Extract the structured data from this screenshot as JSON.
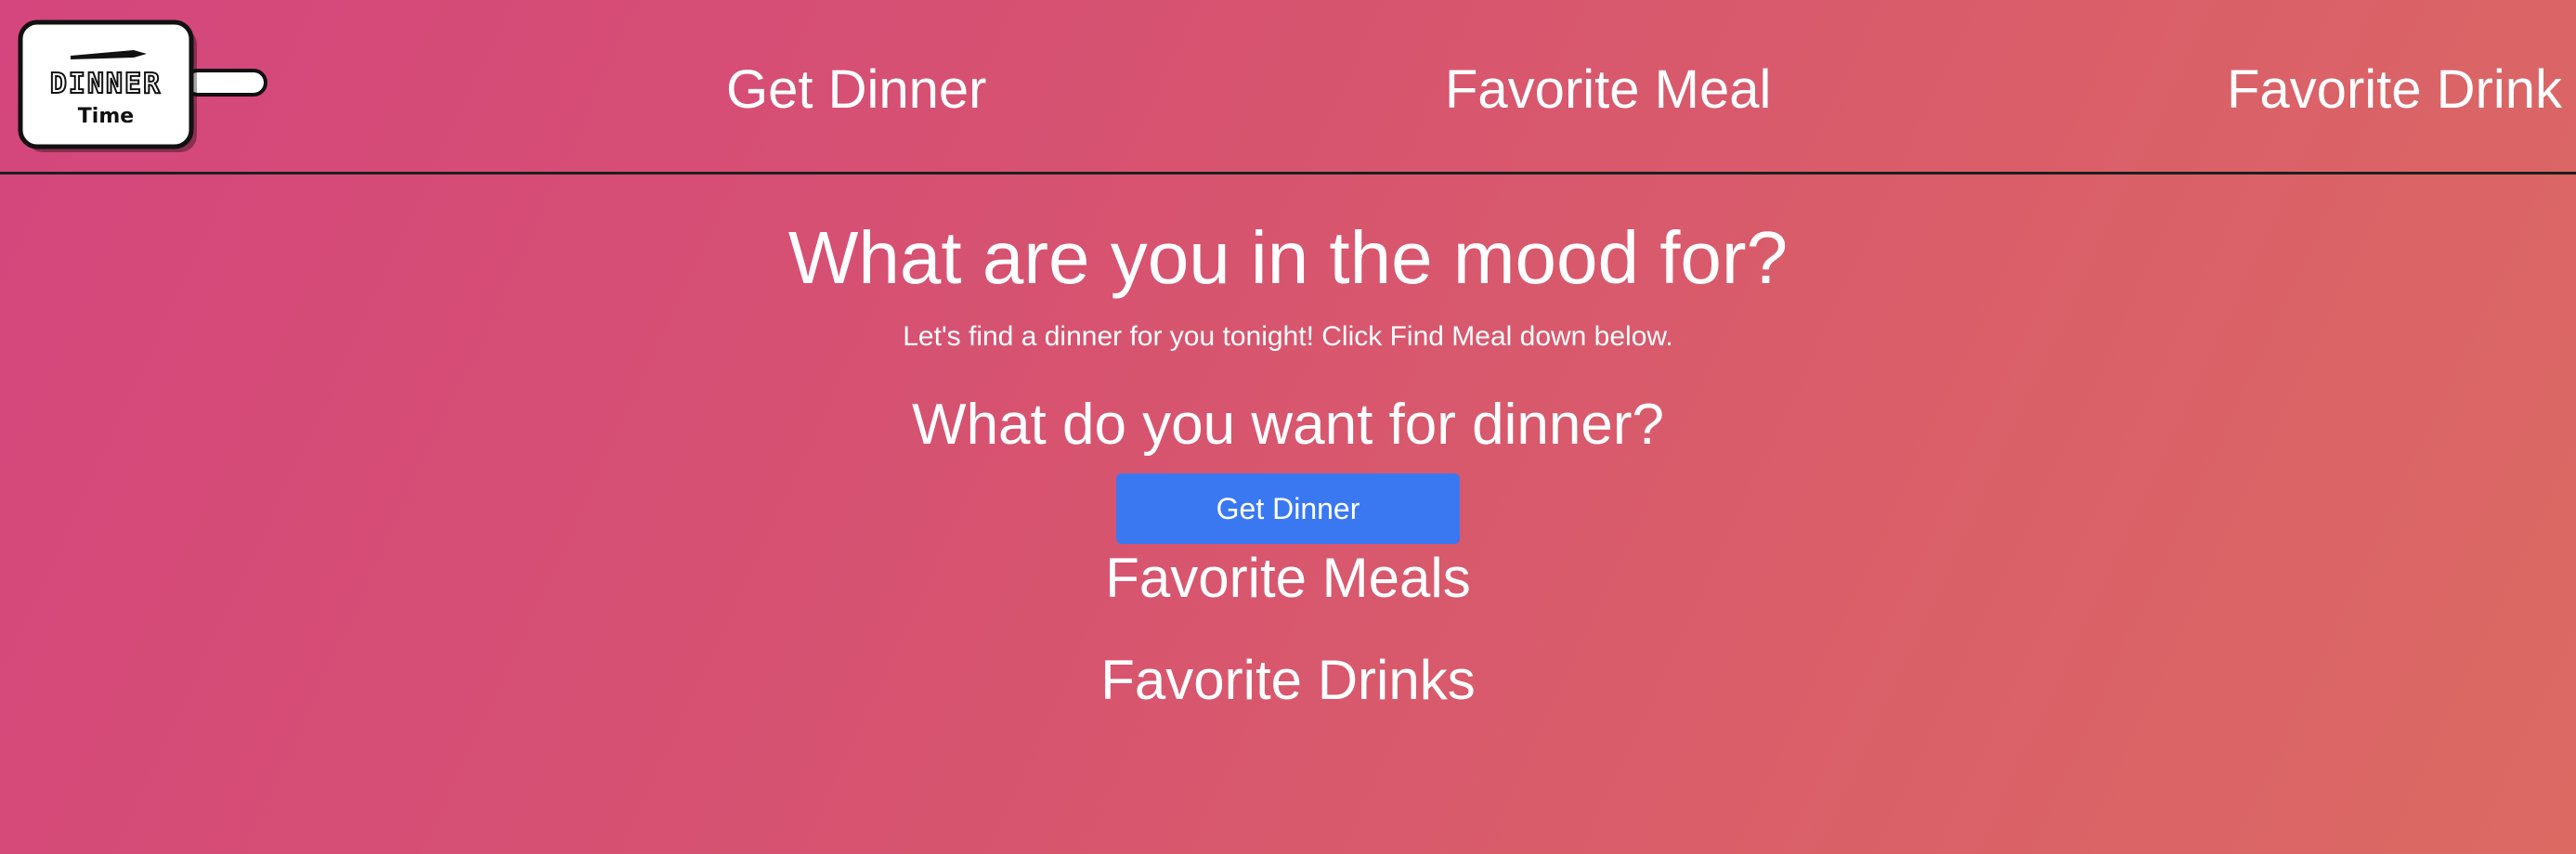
{
  "logo": {
    "line1": "DINNER",
    "line2": "Time",
    "icon": "dinner-plate-pan-icon"
  },
  "nav": {
    "items": [
      {
        "label": "Get Dinner"
      },
      {
        "label": "Favorite Meal"
      },
      {
        "label": "Favorite Drink"
      }
    ]
  },
  "main": {
    "headline": "What are you in the mood for?",
    "subtitle": "Let's find a dinner for you tonight! Click Find Meal down below.",
    "question": "What do you want for dinner?",
    "get_dinner_button": "Get Dinner",
    "favorite_meals_heading": "Favorite Meals",
    "favorite_drinks_heading": "Favorite Drinks"
  },
  "colors": {
    "gradient_start": "#d4467d",
    "gradient_end": "#dc6a63",
    "button_blue": "#3a78f2",
    "text": "#ffffff"
  }
}
